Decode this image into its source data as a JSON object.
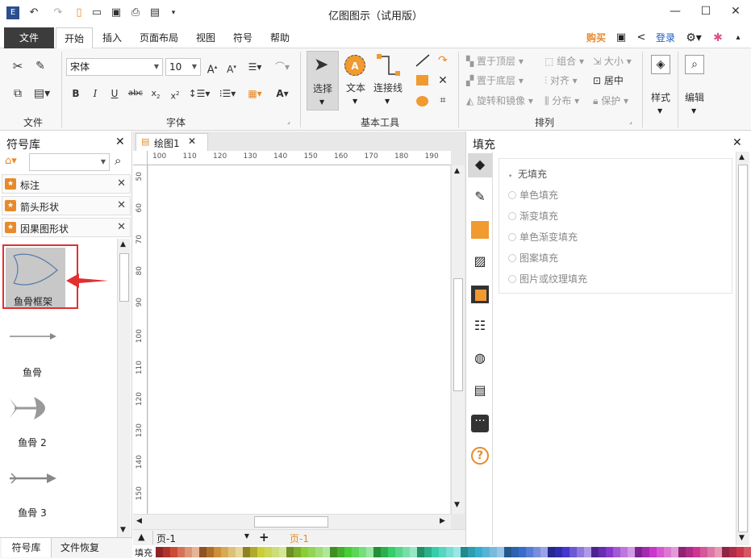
{
  "window": {
    "title": "亿图图示（试用版）"
  },
  "menu": {
    "file": "文件",
    "tabs": [
      "开始",
      "插入",
      "页面布局",
      "视图",
      "符号",
      "帮助"
    ],
    "buy": "购买",
    "login": "登录"
  },
  "ribbon": {
    "font_name": "宋体",
    "font_size": "10",
    "groups": {
      "file": "文件",
      "font": "字体",
      "tools": "基本工具",
      "arrange": "排列"
    },
    "tools": {
      "select": "选择",
      "text": "文本",
      "connector": "连接线"
    },
    "arrange": {
      "bring_front": "置于顶层",
      "send_back": "置于底层",
      "rotate_mirror": "旋转和镜像",
      "group": "组合",
      "align": "对齐",
      "distribute": "分布",
      "size": "大小",
      "center": "居中",
      "protect": "保护"
    },
    "style": "样式",
    "edit": "编辑"
  },
  "symbol_library": {
    "title": "符号库",
    "categories": [
      "标注",
      "箭头形状",
      "因果图形状"
    ],
    "shapes": [
      "鱼骨框架",
      "鱼骨",
      "鱼骨 2",
      "鱼骨 3"
    ],
    "bottom_tabs": [
      "符号库",
      "文件恢复"
    ]
  },
  "document": {
    "tab": "绘图1",
    "ruler_h": [
      "100",
      "110",
      "120",
      "130",
      "140",
      "150",
      "160",
      "170",
      "180",
      "190"
    ],
    "ruler_v": [
      "50",
      "60",
      "70",
      "80",
      "90",
      "100",
      "110",
      "120",
      "130",
      "140",
      "150"
    ],
    "page_select": "页-1",
    "page_tab": "页-1"
  },
  "fill_panel": {
    "title": "填充",
    "options": [
      "无填充",
      "单色填充",
      "渐变填充",
      "单色渐变填充",
      "图案填充",
      "图片或纹理填充"
    ]
  },
  "palette": {
    "label": "填充"
  },
  "colors": {
    "accent": "#e88a2a",
    "highlight": "#e03030",
    "file_tab": "#3c3c3c"
  }
}
